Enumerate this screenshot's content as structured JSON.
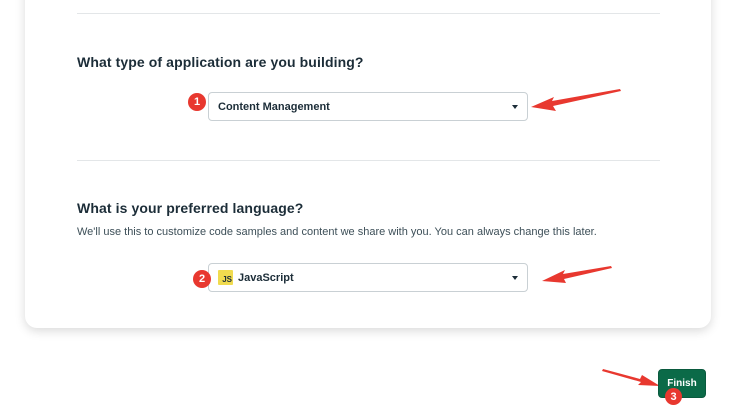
{
  "section_app_type": {
    "question": "What type of application are you building?",
    "selected": "Content Management",
    "badge": "1"
  },
  "section_language": {
    "question": "What is your preferred language?",
    "helper": "We'll use this to customize code samples and content we share with you. You can always change this later.",
    "selected": "JavaScript",
    "icon_text": "JS",
    "badge": "2"
  },
  "footer": {
    "finish_label": "Finish",
    "badge": "3"
  },
  "icons": {
    "dropdown": "chevron-down-icon",
    "language": "javascript-icon",
    "annotation": "red-arrow-icon"
  },
  "colors": {
    "primary_button": "#0b6a48",
    "annotation_red": "#e8382f",
    "js_yellow": "#f0db4f"
  }
}
